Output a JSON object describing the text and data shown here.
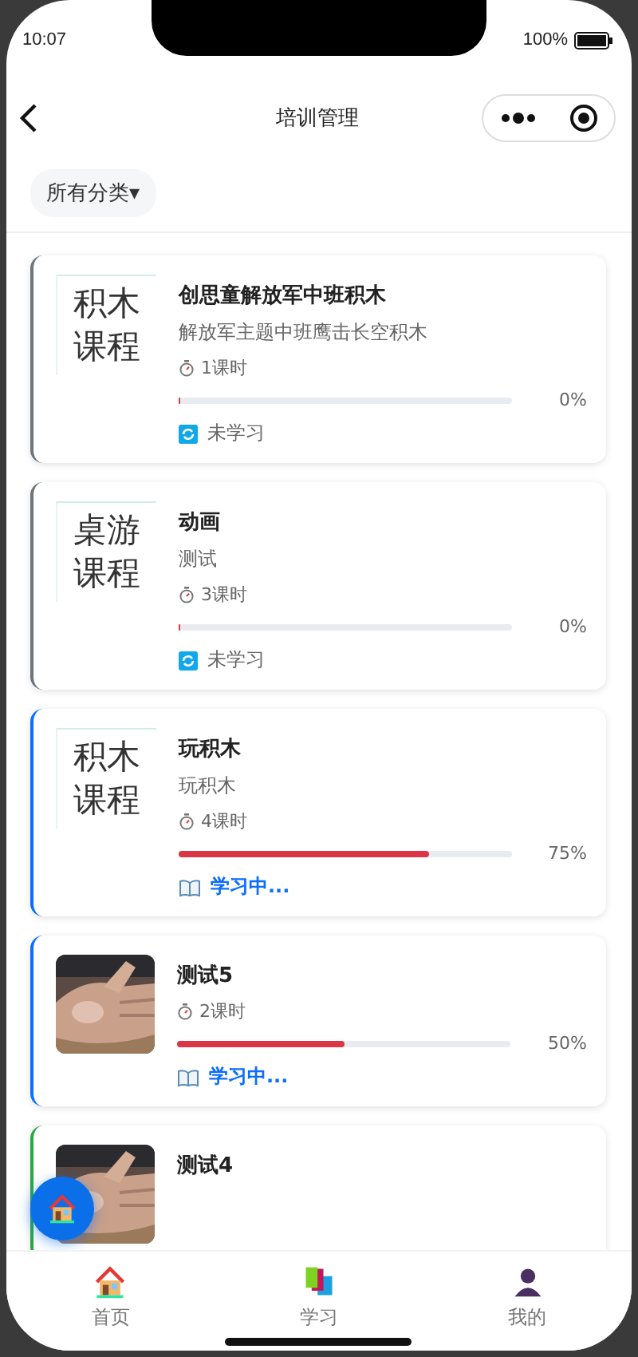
{
  "status_bar": {
    "time": "10:07",
    "battery": "100%"
  },
  "nav": {
    "title": "培训管理"
  },
  "filter": {
    "label": "所有分类▾"
  },
  "courses": [
    {
      "cover": {
        "kind": "text",
        "lines": [
          "积木",
          "课程"
        ]
      },
      "title": "创思童解放军中班积木",
      "subtitle": "解放军主题中班鹰击长空积木",
      "hours": "1课时",
      "level": 0,
      "percent": "0%",
      "status": {
        "kind": "not_started",
        "label": "未学习"
      },
      "color": "#6c757d"
    },
    {
      "cover": {
        "kind": "text",
        "lines": [
          "桌游",
          "课程"
        ]
      },
      "title": "动画",
      "subtitle": "测试",
      "hours": "3课时",
      "level": 0,
      "percent": "0%",
      "status": {
        "kind": "not_started",
        "label": "未学习"
      },
      "color": "#6c757d"
    },
    {
      "cover": {
        "kind": "text",
        "lines": [
          "积木",
          "课程"
        ]
      },
      "title": "玩积木",
      "subtitle": "玩积木",
      "hours": "4课时",
      "level": 0.75,
      "percent": "75%",
      "status": {
        "kind": "in_progress",
        "label": "学习中..."
      },
      "color": "#0d6efd"
    },
    {
      "title": "测试5",
      "hours": "2课时",
      "level": 0.5,
      "percent": "50%",
      "status": {
        "kind": "in_progress",
        "label": "学习中..."
      },
      "color": "#0d6efd"
    },
    {
      "title": "测试4",
      "color": "#28a745"
    }
  ],
  "tabs": [
    {
      "label": "首页",
      "kind": "home"
    },
    {
      "label": "学习",
      "kind": "study"
    },
    {
      "label": "我的",
      "kind": "me"
    }
  ]
}
